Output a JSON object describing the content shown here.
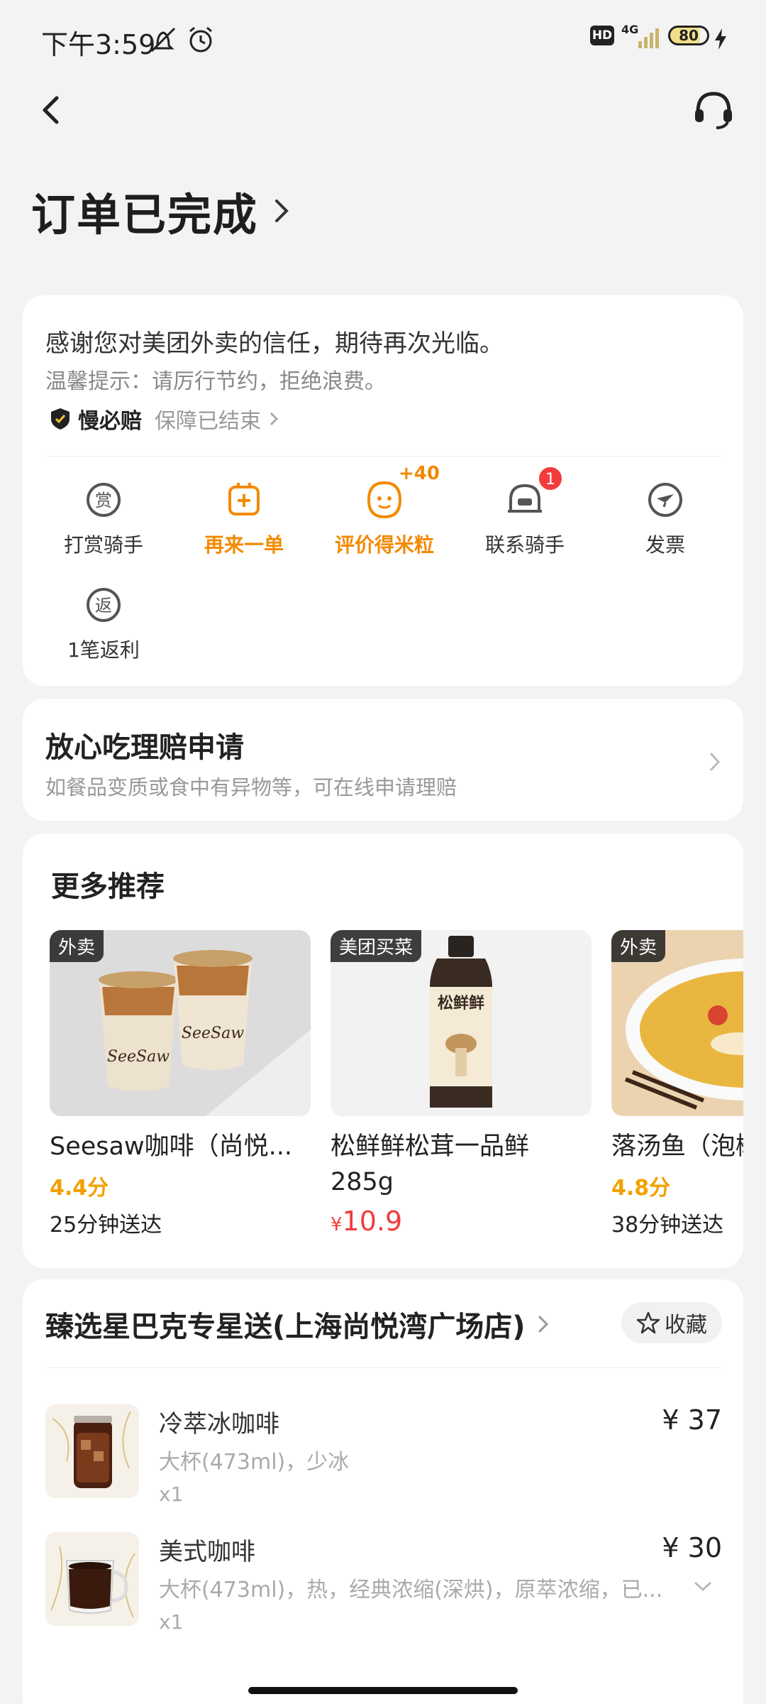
{
  "status_bar": {
    "time": "下午3:59",
    "hd": "HD",
    "network": "4G",
    "battery": "80"
  },
  "header": {
    "title": "订单已完成"
  },
  "order_card": {
    "thanks": "感谢您对美团外卖的信任，期待再次光临。",
    "tip": "温馨提示：请厉行节约，拒绝浪费。",
    "guarantee_name": "慢必赔",
    "guarantee_status": "保障已结束",
    "actions": [
      {
        "label": "打赏骑手",
        "icon": "reward-icon"
      },
      {
        "label": "再来一单",
        "icon": "reorder-icon"
      },
      {
        "label": "评价得米粒",
        "icon": "review-icon",
        "bonus": "+40"
      },
      {
        "label": "联系骑手",
        "icon": "rider-icon",
        "badge": "1"
      },
      {
        "label": "发票",
        "icon": "invoice-icon"
      },
      {
        "label": "1笔返利",
        "icon": "rebate-icon"
      }
    ]
  },
  "claim_card": {
    "title": "放心吃理赔申请",
    "subtitle": "如餐品变质或食中有异物等，可在线申请理赔"
  },
  "recommend": {
    "title": "更多推荐",
    "items": [
      {
        "tag": "外卖",
        "name": "Seesaw咖啡（尚悦...",
        "score": "4.4分",
        "time": "25分钟送达"
      },
      {
        "tag": "美团买菜",
        "name": "松鲜鲜松茸一品鲜285g",
        "price_symbol": "¥",
        "price": "10.9"
      },
      {
        "tag": "外卖",
        "name": "落汤鱼（泡椒",
        "score": "4.8分",
        "time": "38分钟送达"
      }
    ]
  },
  "store": {
    "name": "臻选星巴克专星送(上海尚悦湾广场店)",
    "fav_label": "收藏",
    "products": [
      {
        "name": "冷萃冰咖啡",
        "spec": "大杯(473ml)，少冰",
        "qty": "x1",
        "price": "¥ 37"
      },
      {
        "name": "美式咖啡",
        "spec": "大杯(473ml)，热，经典浓缩(深烘)，原萃浓缩，已...",
        "qty": "x1",
        "price": "¥ 30"
      }
    ]
  },
  "colors": {
    "accent": "#f28a00",
    "price_red": "#f23c3c",
    "score_yellow": "#f2a100",
    "background": "#f3f3f3"
  }
}
